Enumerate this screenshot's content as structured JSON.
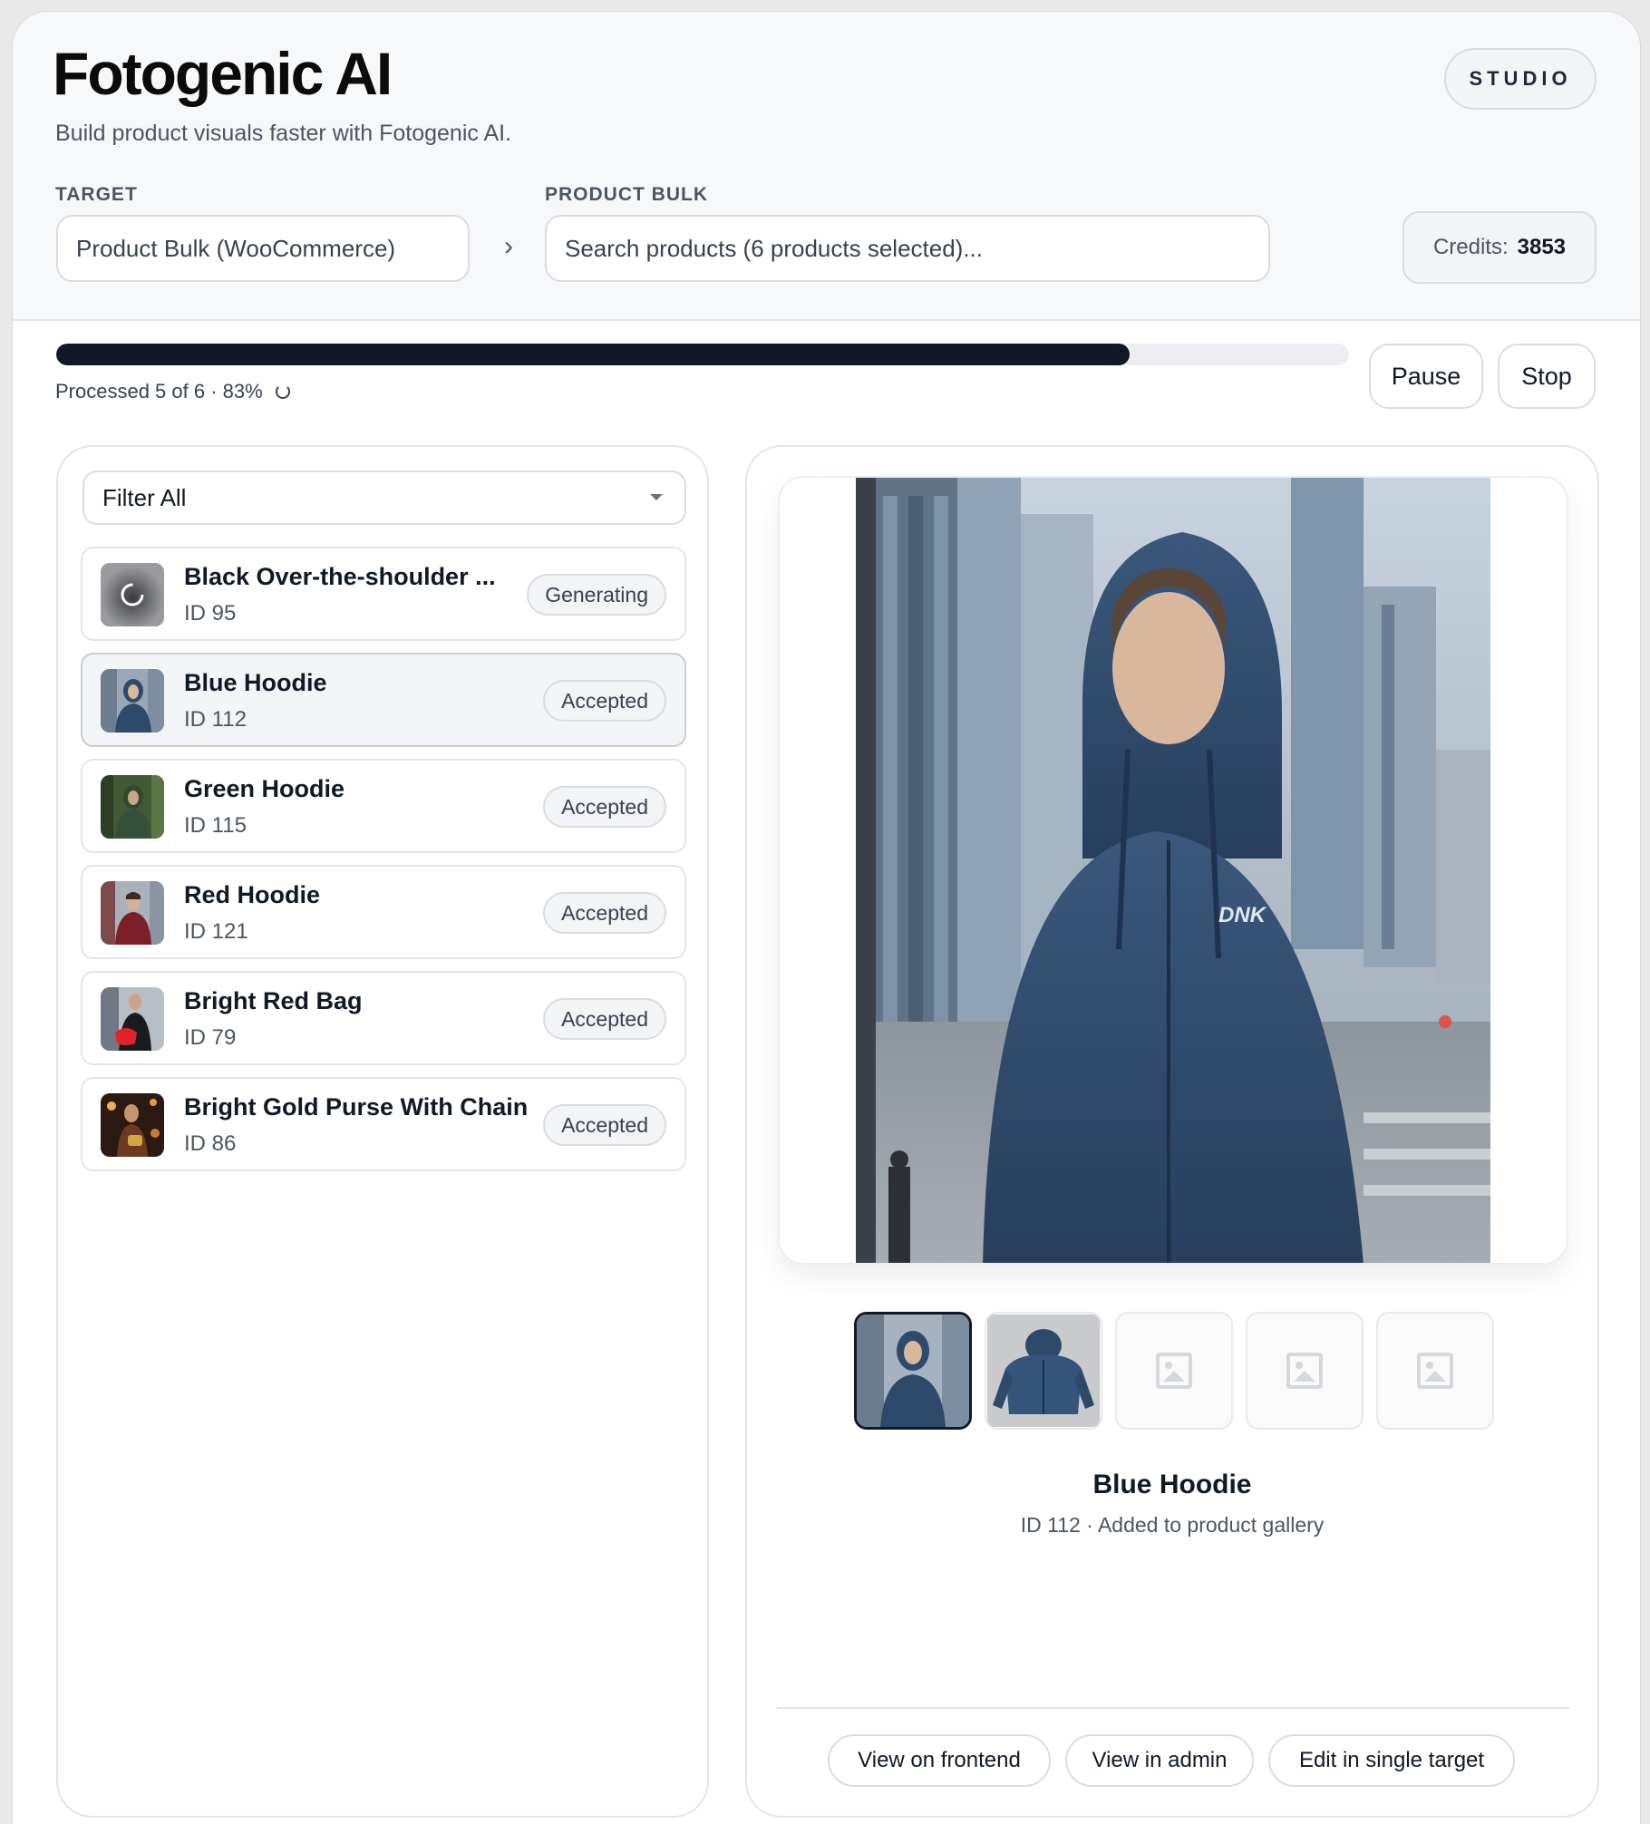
{
  "app": {
    "title": "Fotogenic AI",
    "tagline": "Build product visuals faster with Fotogenic AI.",
    "mode_pill": "STUDIO"
  },
  "header": {
    "target_label": "TARGET",
    "target_value": "Product Bulk (WooCommerce)",
    "bulk_label": "PRODUCT BULK",
    "search_placeholder": "Search products (6 products selected)...",
    "credits_label": "Credits:",
    "credits_value": "3853"
  },
  "progress": {
    "text": "Processed 5 of 6 · 83%",
    "fraction": 0.83,
    "pause_label": "Pause",
    "stop_label": "Stop"
  },
  "list": {
    "filter_value": "Filter All",
    "items": [
      {
        "name": "Black Over-the-shoulder ...",
        "id": "ID 95",
        "status": "Generating",
        "thumb": "loading"
      },
      {
        "name": "Blue Hoodie",
        "id": "ID 112",
        "status": "Accepted",
        "thumb": "blue-hoodie",
        "selected": true
      },
      {
        "name": "Green Hoodie",
        "id": "ID 115",
        "status": "Accepted",
        "thumb": "green-hoodie"
      },
      {
        "name": "Red Hoodie",
        "id": "ID 121",
        "status": "Accepted",
        "thumb": "red-hoodie"
      },
      {
        "name": "Bright Red Bag",
        "id": "ID 79",
        "status": "Accepted",
        "thumb": "red-bag"
      },
      {
        "name": "Bright Gold Purse With Chain",
        "id": "ID 86",
        "status": "Accepted",
        "thumb": "gold-purse"
      }
    ]
  },
  "preview": {
    "title": "Blue Hoodie",
    "subtitle": "ID 112 · Added to product gallery",
    "photo_print": "DNK",
    "gallery": [
      "photo-model",
      "photo-product",
      "placeholder",
      "placeholder",
      "placeholder"
    ],
    "actions": [
      "View on frontend",
      "View in admin",
      "Edit in single target"
    ]
  },
  "colors": {
    "accent": "#111827",
    "hoodie_blue": "#2e4a6b",
    "panel_bg": "#f7f8fa"
  }
}
